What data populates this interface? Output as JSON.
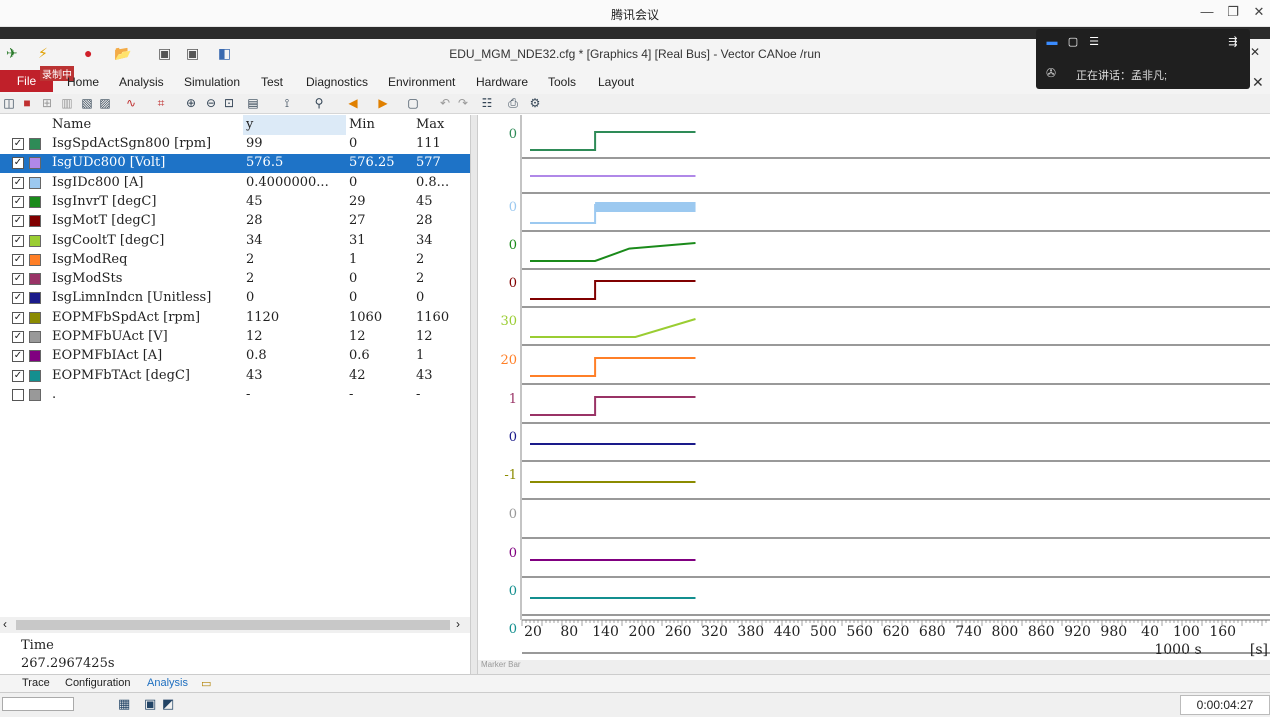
{
  "meeting": {
    "title": "腾讯会议",
    "speaking": "正在讲话：孟非凡;"
  },
  "window": {
    "title": "EDU_MGM_NDE32.cfg * [Graphics 4] [Real Bus] - Vector CANoe /run"
  },
  "ribbon": {
    "file": "File",
    "recorder": "录制中",
    "menu": [
      "Home",
      "Analysis",
      "Simulation",
      "Test",
      "Diagnostics",
      "Environment",
      "Hardware",
      "Tools",
      "Layout"
    ]
  },
  "table": {
    "headers": {
      "name": "Name",
      "y": "y",
      "min": "Min",
      "max": "Max"
    },
    "rows": [
      {
        "name": "IsgSpdActSgn800 [rpm]",
        "y": "99",
        "min": "0",
        "max": "111",
        "color": "#2e8b57",
        "checked": true
      },
      {
        "name": "IsgUDc800 [Volt]",
        "y": "576.5",
        "min": "576.25",
        "max": "577",
        "color": "#b088e8",
        "checked": true,
        "selected": true
      },
      {
        "name": "IsgIDc800 [A]",
        "y": "0.4000000...",
        "min": "0",
        "max": "0.8...",
        "color": "#9cc9f0",
        "checked": true
      },
      {
        "name": "IsgInvrT [degC]",
        "y": "45",
        "min": "29",
        "max": "45",
        "color": "#1a8a1a",
        "checked": true
      },
      {
        "name": "IsgMotT [degC]",
        "y": "28",
        "min": "27",
        "max": "28",
        "color": "#800000",
        "checked": true
      },
      {
        "name": "IsgCooltT [degC]",
        "y": "34",
        "min": "31",
        "max": "34",
        "color": "#9acd32",
        "checked": true
      },
      {
        "name": "IsgModReq",
        "y": "2",
        "min": "1",
        "max": "2",
        "color": "#ff7f27",
        "checked": true
      },
      {
        "name": "IsgModSts",
        "y": "2",
        "min": "0",
        "max": "2",
        "color": "#993366",
        "checked": true
      },
      {
        "name": "IsgLimnIndcn [Unitless]",
        "y": "0",
        "min": "0",
        "max": "0",
        "color": "#1a1a8a",
        "checked": true
      },
      {
        "name": "EOPMFbSpdAct [rpm]",
        "y": "1120",
        "min": "1060",
        "max": "1160",
        "color": "#8b8b00",
        "checked": true
      },
      {
        "name": "EOPMFbUAct [V]",
        "y": "12",
        "min": "12",
        "max": "12",
        "color": "#999999",
        "checked": true
      },
      {
        "name": "EOPMFbIAct [A]",
        "y": "0.8",
        "min": "0.6",
        "max": "1",
        "color": "#800080",
        "checked": true
      },
      {
        "name": "EOPMFbTAct [degC]",
        "y": "43",
        "min": "42",
        "max": "43",
        "color": "#138f8f",
        "checked": true
      },
      {
        "name": ".",
        "y": "-",
        "min": "-",
        "max": "-",
        "color": "#999999",
        "checked": false
      }
    ]
  },
  "time_panel": {
    "label": "Time",
    "value": "267.2967425s"
  },
  "graph": {
    "marker_bar": "Marker Bar",
    "axis_unit": "[s]",
    "axis_multiplier": "1000 s",
    "x_ticks": [
      "20",
      "80",
      "140",
      "200",
      "260",
      "320",
      "380",
      "440",
      "500",
      "560",
      "620",
      "680",
      "740",
      "800",
      "860",
      "920",
      "980",
      "40",
      "100",
      "160"
    ],
    "lane_labels": [
      "0",
      "",
      "0",
      "0",
      "0",
      "30",
      "20",
      "1",
      "0",
      "-1",
      "0",
      "0",
      "0",
      "0"
    ]
  },
  "chart_data": {
    "type": "line",
    "xlabel": "[s]",
    "x_end": 267.3,
    "series": [
      {
        "name": "IsgSpdActSgn800 [rpm]",
        "color": "#2e8b57",
        "points": [
          [
            0,
            0
          ],
          [
            105,
            0
          ],
          [
            105,
            99
          ],
          [
            267,
            99
          ]
        ]
      },
      {
        "name": "IsgUDc800 [Volt]",
        "color": "#b088e8",
        "points": [
          [
            0,
            576.5
          ],
          [
            267,
            576.5
          ]
        ]
      },
      {
        "name": "IsgIDc800 [A]",
        "color": "#9cc9f0",
        "points": [
          [
            0,
            0
          ],
          [
            105,
            0
          ],
          [
            105,
            0.4
          ],
          [
            267,
            0.4
          ]
        ]
      },
      {
        "name": "IsgInvrT [degC]",
        "color": "#1a8a1a",
        "points": [
          [
            0,
            29
          ],
          [
            105,
            29
          ],
          [
            160,
            40
          ],
          [
            267,
            45
          ]
        ]
      },
      {
        "name": "IsgMotT [degC]",
        "color": "#800000",
        "points": [
          [
            0,
            27
          ],
          [
            105,
            27
          ],
          [
            105,
            28
          ],
          [
            267,
            28
          ]
        ]
      },
      {
        "name": "IsgCooltT [degC]",
        "color": "#9acd32",
        "points": [
          [
            0,
            31
          ],
          [
            170,
            31
          ],
          [
            267,
            34
          ]
        ]
      },
      {
        "name": "IsgModReq",
        "color": "#ff7f27",
        "points": [
          [
            0,
            1
          ],
          [
            105,
            1
          ],
          [
            105,
            2
          ],
          [
            267,
            2
          ]
        ]
      },
      {
        "name": "IsgModSts",
        "color": "#993366",
        "points": [
          [
            0,
            0
          ],
          [
            105,
            0
          ],
          [
            105,
            2
          ],
          [
            267,
            2
          ]
        ]
      },
      {
        "name": "IsgLimnIndcn [Unitless]",
        "color": "#1a1a8a",
        "points": [
          [
            0,
            0
          ],
          [
            267,
            0
          ]
        ]
      },
      {
        "name": "EOPMFbSpdAct [rpm]",
        "color": "#8b8b00",
        "points": [
          [
            0,
            1120
          ],
          [
            267,
            1120
          ]
        ]
      },
      {
        "name": "EOPMFbIAct [A]",
        "color": "#800080",
        "points": [
          [
            0,
            0.8
          ],
          [
            267,
            0.8
          ]
        ]
      },
      {
        "name": "EOPMFbTAct [degC]",
        "color": "#138f8f",
        "points": [
          [
            0,
            43
          ],
          [
            267,
            43
          ]
        ]
      }
    ]
  },
  "bottom_tabs": [
    "Trace",
    "Configuration",
    "Analysis"
  ],
  "status": {
    "elapsed": "0:00:04:27"
  }
}
